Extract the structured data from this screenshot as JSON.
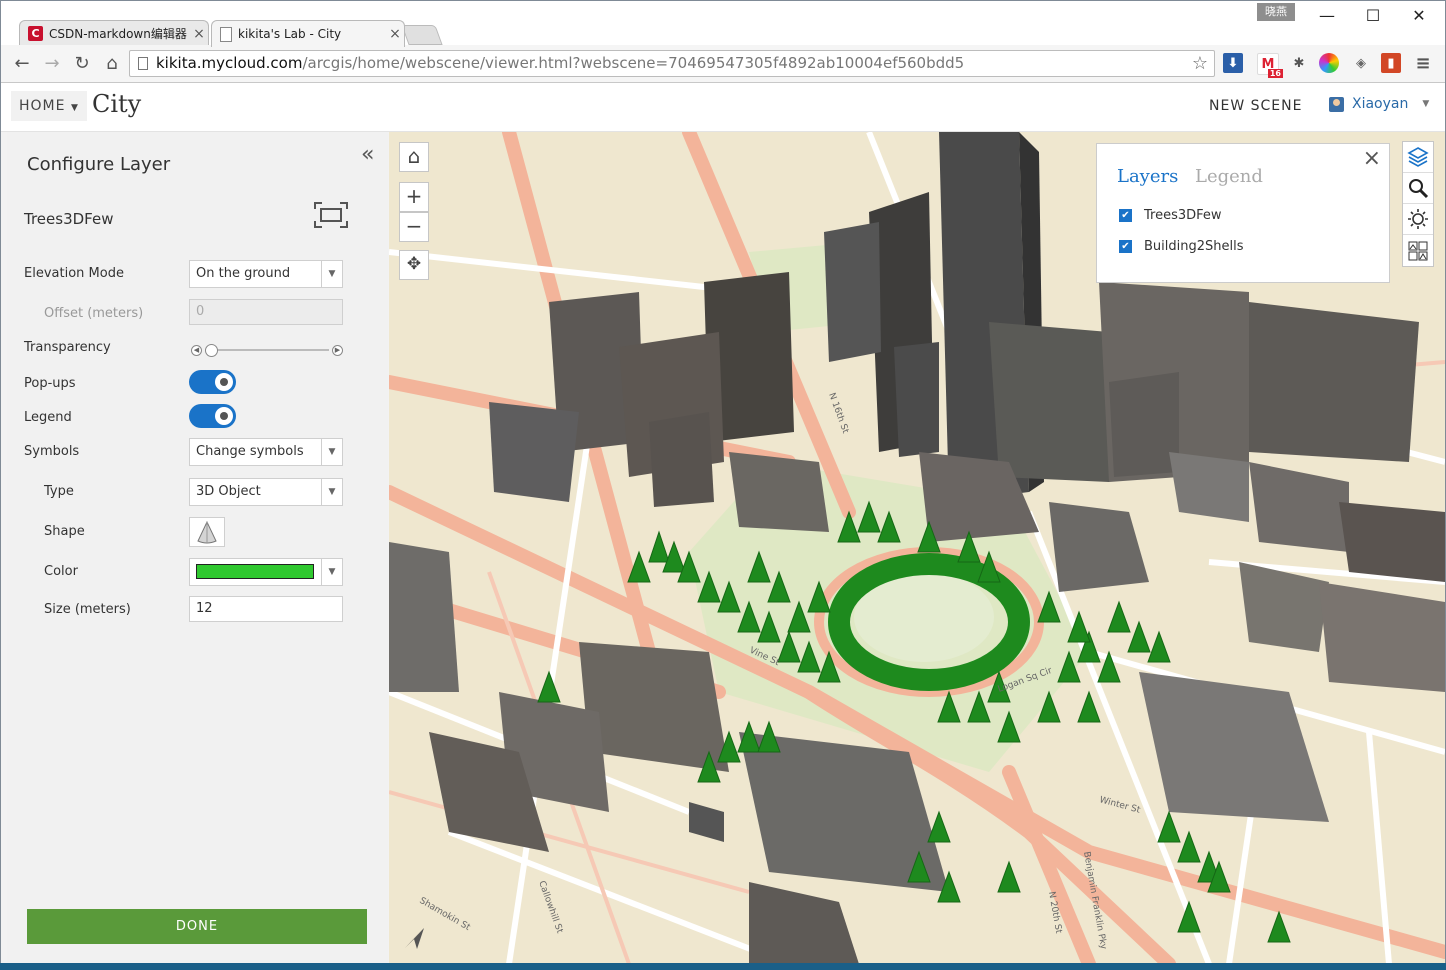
{
  "browser": {
    "tabs": [
      {
        "title": "CSDN-markdown编辑器",
        "icon": "csdn-favicon-icon",
        "active": false
      },
      {
        "title": "kikita's Lab - City",
        "icon": "page-document-icon",
        "active": true
      }
    ],
    "ime_badge": "晓燕",
    "url_host": "kikita.mycloud.com",
    "url_path": "/arcgis/home/webscene/viewer.html?webscene=70469547305f4892ab10004ef560bdd5",
    "gmail_badge": "16"
  },
  "app": {
    "home_label": "HOME",
    "title": "City",
    "new_scene": "NEW SCENE",
    "user": "Xiaoyan"
  },
  "panel": {
    "title": "Configure Layer",
    "layer_name": "Trees3DFew",
    "elevation_label": "Elevation Mode",
    "elevation_value": "On the ground",
    "offset_label": "Offset (meters)",
    "offset_value": "0",
    "transparency_label": "Transparency",
    "transparency_value": 0,
    "popups_label": "Pop-ups",
    "popups_on": true,
    "legend_label": "Legend",
    "legend_on": true,
    "symbols_label": "Symbols",
    "symbols_value": "Change symbols",
    "type_label": "Type",
    "type_value": "3D Object",
    "shape_label": "Shape",
    "color_label": "Color",
    "color_value": "#2fc82f",
    "size_label": "Size (meters)",
    "size_value": "12",
    "done_label": "DONE"
  },
  "layers_panel": {
    "tab_layers": "Layers",
    "tab_legend": "Legend",
    "items": [
      {
        "name": "Trees3DFew",
        "checked": true
      },
      {
        "name": "Building2Shells",
        "checked": true
      }
    ]
  },
  "colors": {
    "accent": "#1a73c8",
    "done_button": "#5a9a3a",
    "map_base": "#efe7cf",
    "road": "#f3b49a",
    "tree": "#1e8a1e"
  }
}
